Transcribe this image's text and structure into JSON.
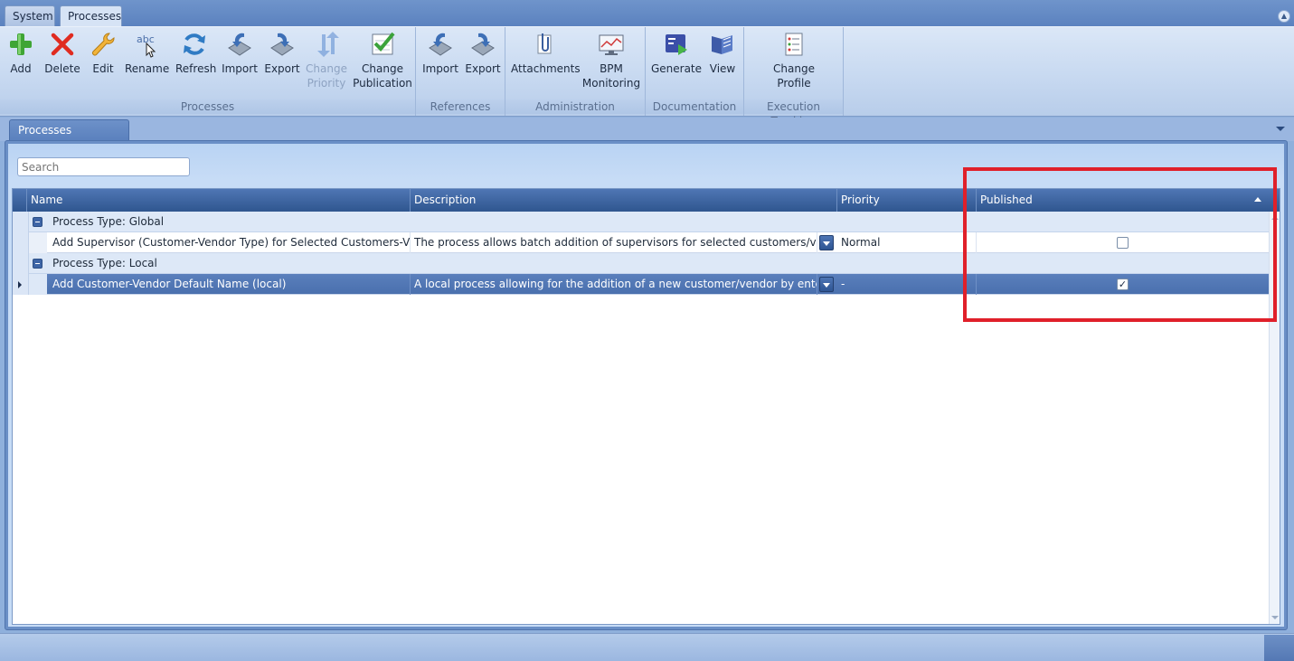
{
  "top_tabs": {
    "system": "System",
    "processes": "Processes"
  },
  "ribbon": {
    "groups": {
      "processes": "Processes",
      "references": "References",
      "administration": "Administration",
      "documentation": "Documentation",
      "execution_tracking": "Execution Tracking"
    },
    "buttons": {
      "add": "Add",
      "delete": "Delete",
      "edit": "Edit",
      "rename": "Rename",
      "refresh": "Refresh",
      "import": "Import",
      "export": "Export",
      "change_priority_1": "Change",
      "change_priority_2": "Priority",
      "change_publication_1": "Change",
      "change_publication_2": "Publication",
      "ref_import": "Import",
      "ref_export": "Export",
      "attachments": "Attachments",
      "bpm_monitoring_1": "BPM",
      "bpm_monitoring_2": "Monitoring",
      "generate": "Generate",
      "view": "View",
      "change_profile_1": "Change",
      "change_profile_2": "Profile"
    },
    "rename_icon_text": "abc"
  },
  "doc_tab": {
    "label": "Processes"
  },
  "search": {
    "placeholder": "Search"
  },
  "grid": {
    "columns": {
      "name": "Name",
      "description": "Description",
      "priority": "Priority",
      "published": "Published"
    },
    "groups": [
      {
        "label": "Process Type: Global",
        "rows": [
          {
            "name": "Add Supervisor (Customer-Vendor Type) for Selected Customers-Vendors",
            "description": "The process allows batch addition of supervisors for selected customers/vendors. Th",
            "priority": "Normal",
            "published": false,
            "published_mark": ""
          }
        ]
      },
      {
        "label": "Process Type: Local",
        "rows": [
          {
            "name": "Add Customer-Vendor Default Name (local)",
            "description": "A local process allowing for the addition of a new customer/vendor by entering a de",
            "priority": "-",
            "published": true,
            "published_mark": "✓"
          }
        ]
      }
    ]
  },
  "colors": {
    "highlight": "#e0202a",
    "header": "#3a609c",
    "selected_row": "#5278b8"
  }
}
